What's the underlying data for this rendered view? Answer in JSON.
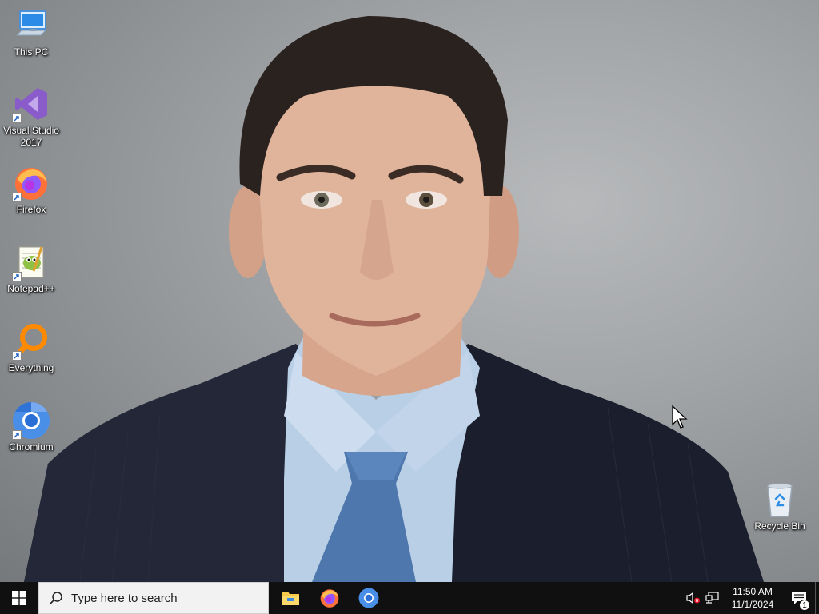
{
  "desktop": {
    "icons": [
      {
        "label": "This PC",
        "icon": "computer-icon",
        "shortcut": false
      },
      {
        "label": "Visual Studio\n2017",
        "icon": "visual-studio-icon",
        "shortcut": true
      },
      {
        "label": "Firefox",
        "icon": "firefox-icon",
        "shortcut": true
      },
      {
        "label": "Notepad++",
        "icon": "notepad-plus-plus-icon",
        "shortcut": true
      },
      {
        "label": "Everything",
        "icon": "everything-search-icon",
        "shortcut": true
      },
      {
        "label": "Chromium",
        "icon": "chromium-icon",
        "shortcut": true
      }
    ],
    "recycle_bin": {
      "label": "Recycle Bin",
      "icon": "recycle-bin-icon"
    }
  },
  "taskbar": {
    "start_icon": "windows-logo-icon",
    "search": {
      "placeholder": "Type here to search",
      "value": ""
    },
    "pinned_apps": [
      {
        "name": "File Explorer",
        "icon": "folder-icon"
      },
      {
        "name": "Firefox",
        "icon": "firefox-icon"
      },
      {
        "name": "Chromium",
        "icon": "chromium-icon"
      }
    ],
    "tray": {
      "volume_icon": "speaker-muted-icon",
      "network_icon": "network-icon",
      "time": "11:50 AM",
      "date": "11/1/2024",
      "notification_count": "1"
    }
  },
  "colors": {
    "taskbar": "#101010",
    "search_box": "#f2f2f2",
    "windows_blue": "#0078d7"
  }
}
